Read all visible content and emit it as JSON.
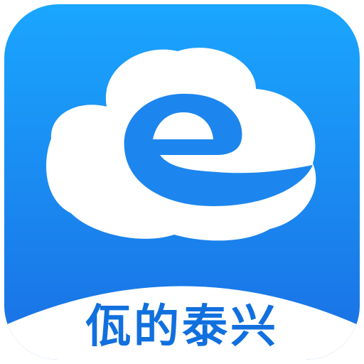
{
  "app": {
    "name": "佤的泰兴",
    "logo_icon": "cloud-e-logo-icon"
  },
  "colors": {
    "tile_gradient_top": "#1aa6ff",
    "tile_gradient_bottom": "#1a6fe3",
    "cloud_fill": "#ffffff",
    "swirl_fill": "#1c86ee",
    "bottom_band": "#ffffff",
    "label_color": "#1170de"
  }
}
